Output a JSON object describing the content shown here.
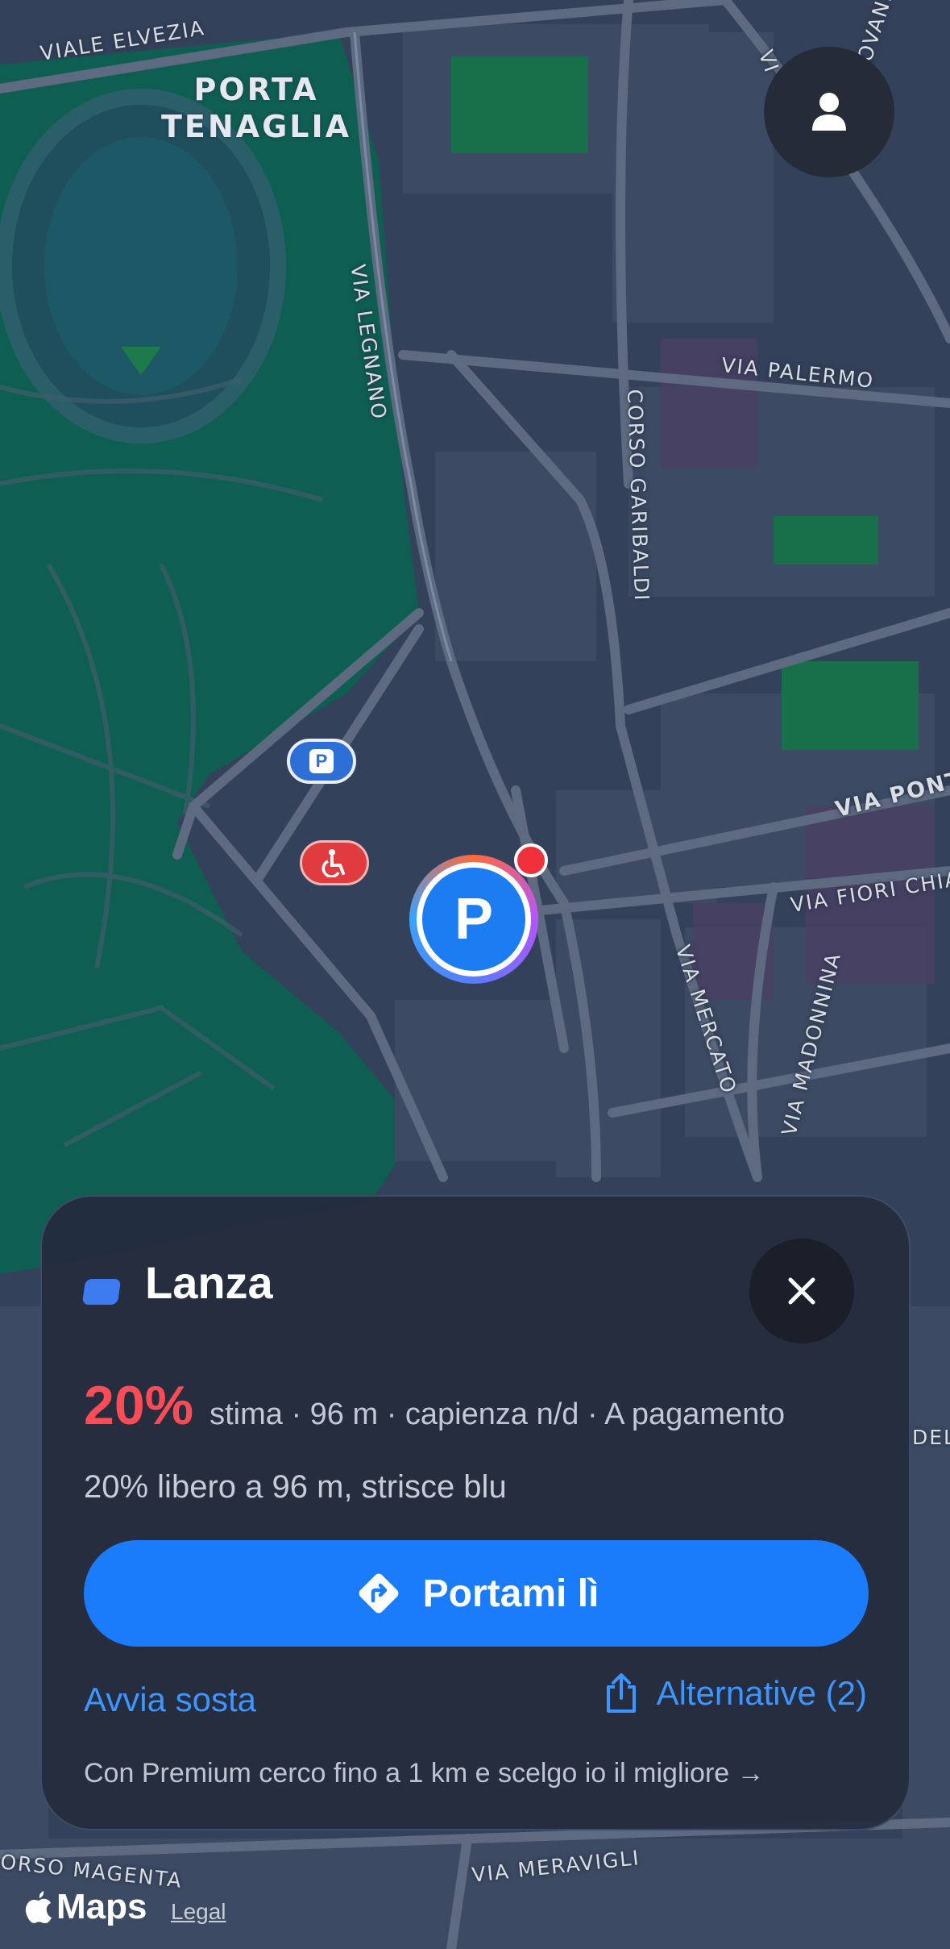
{
  "map": {
    "district": "PORTA\nTENAGLIA",
    "streets": {
      "viale_elvezia": "VIALE ELVEZIA",
      "via_legnano": "VIA LEGNANO",
      "corso_garibaldi": "CORSO GARIBALDI",
      "via_palermo": "VIA PALERMO",
      "via_lovanio": "VIA LOVANIO",
      "via_pont": "VIA PONT",
      "via_fiori_chiar": "VIA FIORI CHIAR",
      "via_mercato": "VIA MERCATO",
      "via_madonnina": "VIA MADONNINA",
      "via_meravigli": "VIA MERAVIGLI",
      "corso_magenta": "ORSO MAGENTA",
      "via_top": "VI",
      "right_edge": "DEL /"
    },
    "pins": {
      "parking_small": "P",
      "main": "P"
    }
  },
  "card": {
    "title": "Lanza",
    "percent": "20%",
    "stats": "stima · 96 m · capienza n/d · A pagamento",
    "description": "20% libero a 96 m, strisce blu",
    "navigate_label": "Portami lì",
    "start_parking_label": "Avvia sosta",
    "alternatives_label": "Alternative (2)",
    "premium_text": "Con Premium cerco fino a 1 km e scelgo io il migliore →"
  },
  "footer": {
    "maps_label": "Maps",
    "legal_label": "Legal"
  },
  "icons": {
    "profile": "person-icon",
    "close": "close-icon",
    "directions": "turn-right-diamond-icon",
    "share": "share-icon",
    "apple": "apple-logo-icon"
  },
  "colors": {
    "accent": "#1a7bfb",
    "percent": "#ff4b55",
    "link": "#3d95ff",
    "park": "#0e5f52",
    "card_bg": "#242c3e"
  }
}
